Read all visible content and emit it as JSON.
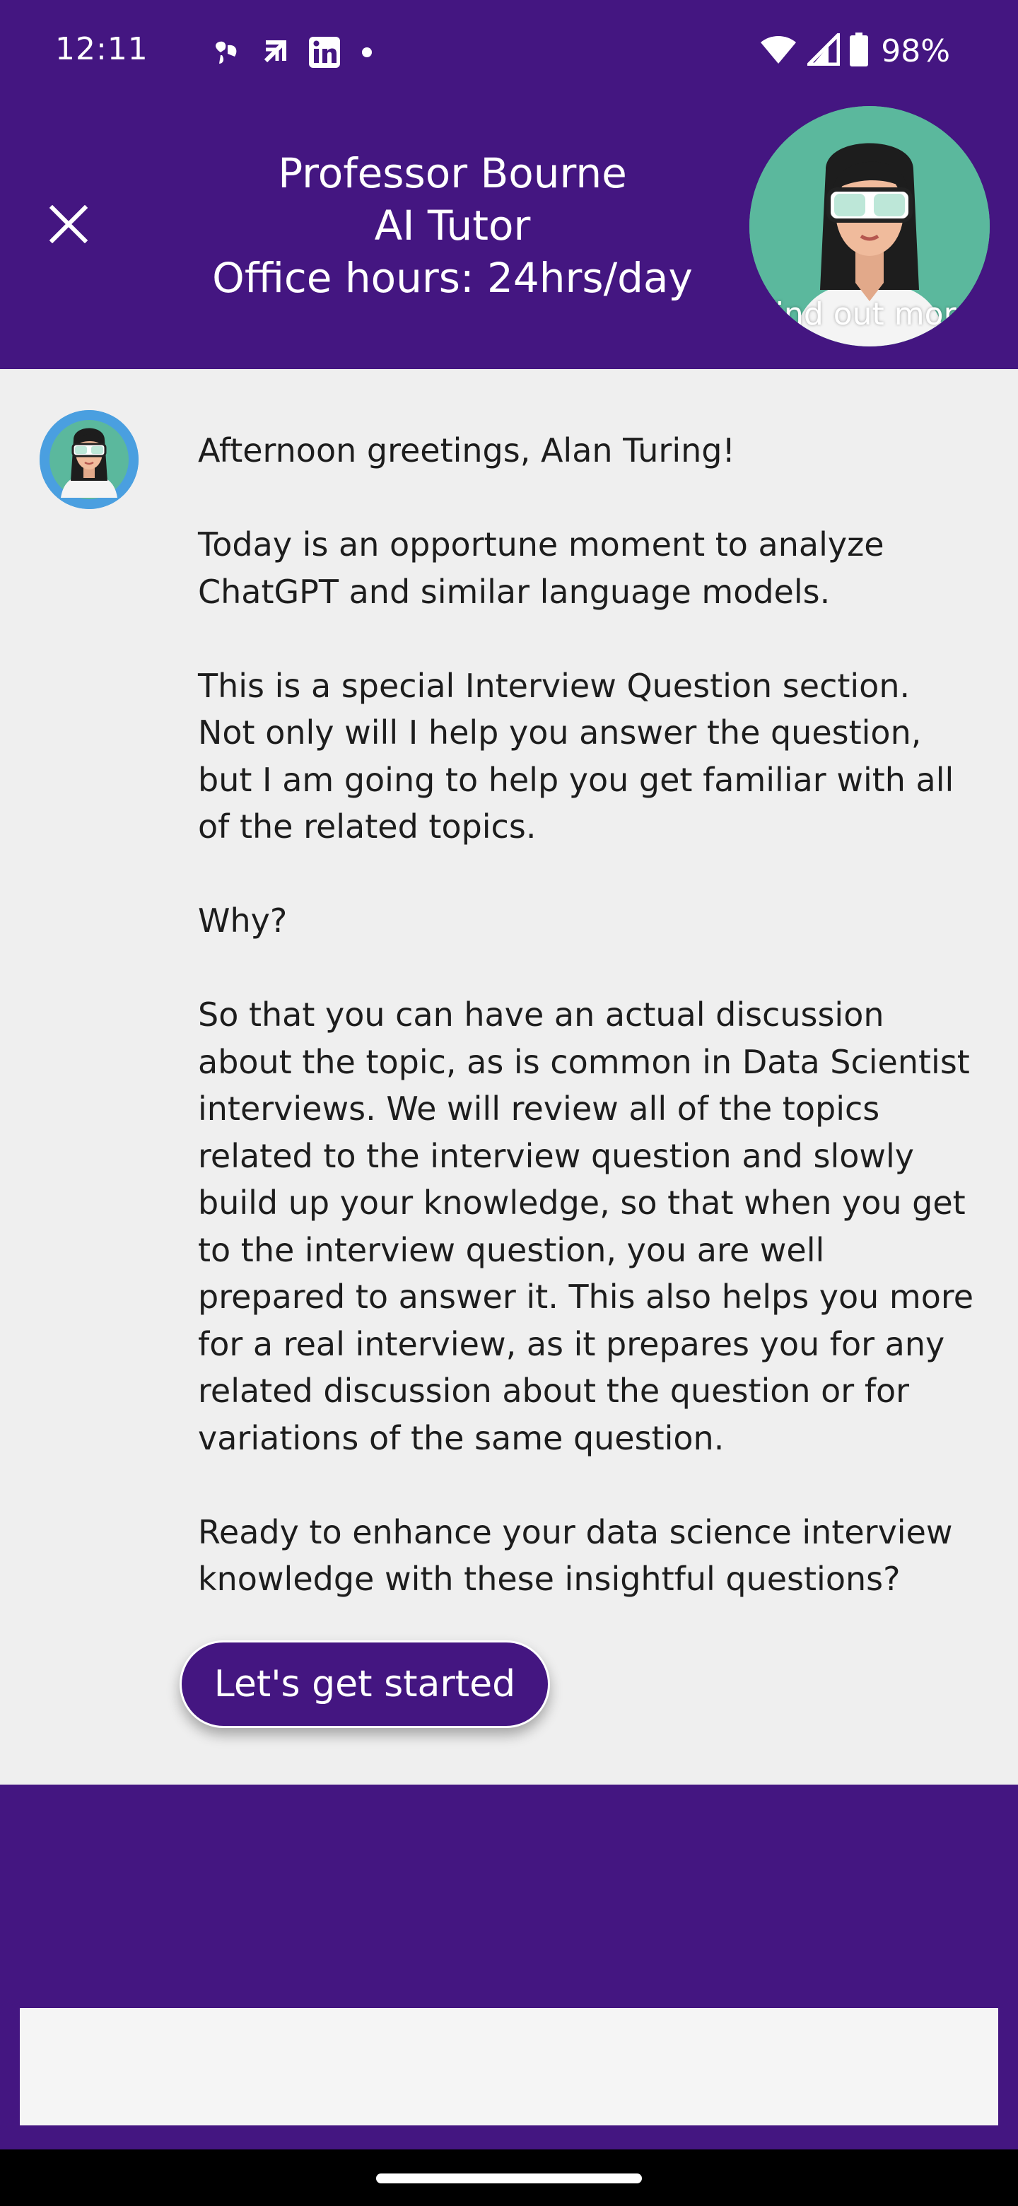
{
  "status_bar": {
    "time": "12:11",
    "battery": "98%",
    "left_icons": [
      "pinwheel-icon",
      "arrow-icon",
      "linkedin-icon",
      "dot-icon"
    ],
    "right_icons": [
      "wifi-icon",
      "signal-icon",
      "battery-icon"
    ]
  },
  "header": {
    "title_lines": [
      "Professor Bourne",
      "AI Tutor",
      "Office hours: 24hrs/day"
    ],
    "find_out_more": "find out more",
    "close_icon": "close-icon"
  },
  "chat": {
    "message_paragraphs": [
      "Afternoon greetings, Alan Turing!",
      "Today is an opportune moment to analyze ChatGPT and similar language models.",
      "This is a special Interview Question section. Not only will I help you answer the question, but I am going to help you get familiar with all of the related topics.",
      "Why?",
      "So that you can have an actual discussion about the topic, as is common in Data Scientist interviews. We will review all of the topics related to the interview question and slowly build up your knowledge, so that when you get to the interview question, you are well prepared to answer it.  This also helps you more for a real interview, as it prepares you for any related discussion about the question or for variations of the same question.",
      "Ready to enhance your data science interview knowledge with these insightful questions?"
    ],
    "cta_label": "Let's get started"
  },
  "input": {
    "value": "",
    "placeholder": ""
  },
  "colors": {
    "brand_purple": "#441681",
    "content_bg": "#efefef",
    "avatar_bg_large": "#5bb89d",
    "avatar_bg_small": "#4a9fe0"
  }
}
